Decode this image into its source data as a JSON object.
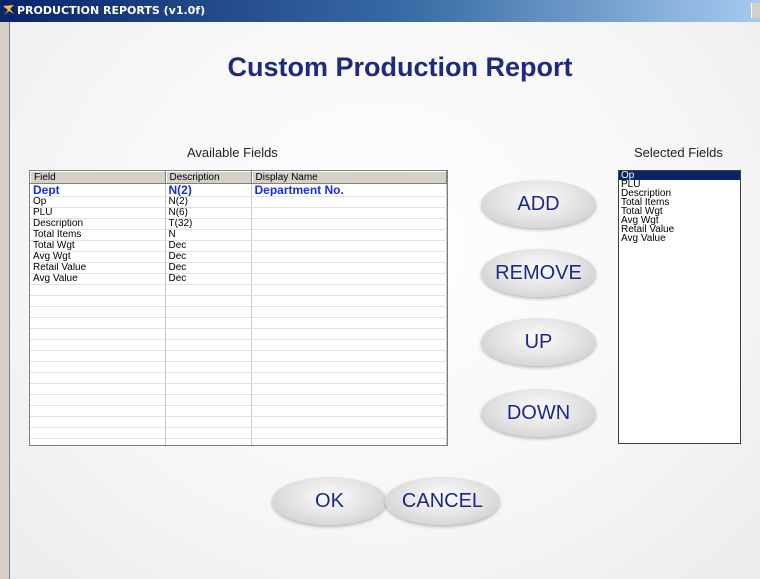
{
  "window": {
    "title": "PRODUCTION REPORTS (v1.0f)"
  },
  "page": {
    "title": "Custom Production Report"
  },
  "available": {
    "label": "Available Fields",
    "columns": [
      "Field",
      "Description",
      "Display Name"
    ],
    "rows": [
      {
        "field": "Dept",
        "desc": "N(2)",
        "display": "Department No."
      },
      {
        "field": "Op",
        "desc": "N(2)",
        "display": ""
      },
      {
        "field": "PLU",
        "desc": "N(6)",
        "display": ""
      },
      {
        "field": "Description",
        "desc": "T(32)",
        "display": ""
      },
      {
        "field": "Total Items",
        "desc": "N",
        "display": ""
      },
      {
        "field": "Total Wgt",
        "desc": "Dec",
        "display": ""
      },
      {
        "field": "Avg Wgt",
        "desc": "Dec",
        "display": ""
      },
      {
        "field": "Retail Value",
        "desc": "Dec",
        "display": ""
      },
      {
        "field": "Avg Value",
        "desc": "Dec",
        "display": ""
      }
    ]
  },
  "selected": {
    "label": "Selected Fields",
    "items": [
      "Op",
      "PLU",
      "Description",
      "Total Items",
      "Total Wgt",
      "Avg Wgt",
      "Retail Value",
      "Avg Value"
    ]
  },
  "buttons": {
    "add": "ADD",
    "remove": "REMOVE",
    "up": "UP",
    "down": "DOWN",
    "ok": "OK",
    "cancel": "CANCEL"
  },
  "colors": {
    "title_blue": "#1f2a7c",
    "selected_row": "#1a2ee0",
    "list_highlight": "#0a246a"
  }
}
